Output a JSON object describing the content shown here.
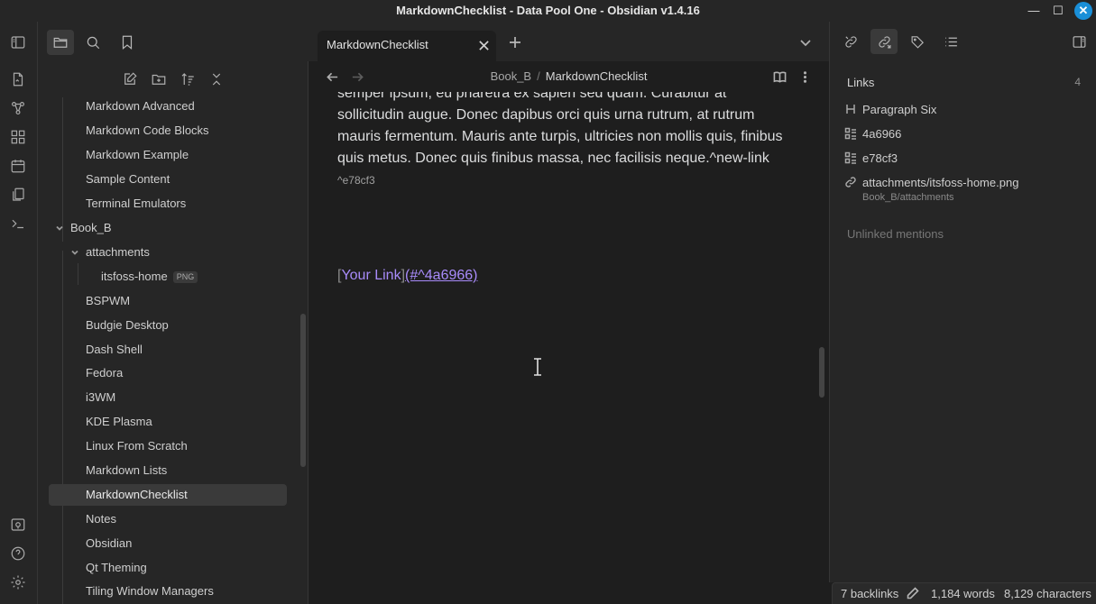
{
  "window": {
    "title": "MarkdownChecklist - Data Pool One - Obsidian v1.4.16",
    "minimize_icon": "minimize-icon",
    "maximize_icon": "maximize-icon",
    "close_icon": "close-icon"
  },
  "colors": {
    "background": "#1e1e1e",
    "panel": "#262626",
    "accent_link": "#a88bfa",
    "close_button": "#1a8fd8"
  },
  "ribbon": {
    "icons": [
      "new-note-icon",
      "graph-view-icon",
      "canvas-icon",
      "daily-note-icon",
      "templates-icon",
      "command-palette-icon",
      "vault-switcher-icon",
      "help-icon",
      "settings-icon"
    ]
  },
  "left_top": {
    "icons": [
      "toggle-left-sidebar-icon",
      "file-explorer-icon",
      "search-icon",
      "bookmarks-icon"
    ]
  },
  "file_nav": {
    "actions": [
      "new-note-icon",
      "new-folder-icon",
      "sort-icon",
      "collapse-all-icon"
    ],
    "items": [
      {
        "label": "Markdown Advanced"
      },
      {
        "label": "Markdown Code Blocks"
      },
      {
        "label": "Markdown Example"
      },
      {
        "label": "Sample Content"
      },
      {
        "label": "Terminal Emulators"
      },
      {
        "label": "Book_B"
      },
      {
        "label": "attachments"
      },
      {
        "label": "itsfoss-home",
        "badge": "PNG"
      },
      {
        "label": "BSPWM"
      },
      {
        "label": "Budgie Desktop"
      },
      {
        "label": "Dash Shell"
      },
      {
        "label": "Fedora"
      },
      {
        "label": "i3WM"
      },
      {
        "label": "KDE Plasma"
      },
      {
        "label": "Linux From Scratch"
      },
      {
        "label": "Markdown Lists"
      },
      {
        "label": "MarkdownChecklist",
        "selected": true
      },
      {
        "label": "Notes"
      },
      {
        "label": "Obsidian"
      },
      {
        "label": "Qt Theming"
      },
      {
        "label": "Tiling Window Managers"
      }
    ]
  },
  "tabs": {
    "active_title": "MarkdownChecklist",
    "new_tab_icon": "plus-icon",
    "tab_list_icon": "chevron-down-icon"
  },
  "editor": {
    "breadcrumb_parent": "Book_B",
    "breadcrumb_sep": "/",
    "breadcrumb_current": "MarkdownChecklist",
    "paragraph_text": "semper ipsum, eu pharetra ex sapien sed quam. Curabitur at sollicitudin augue. Donec dapibus orci quis urna rutrum, at rutrum mauris fermentum. Mauris ante turpis, ultricies non mollis quis, finibus quis metus. Donec quis finibus massa, nec facilisis neque.^new-link",
    "block_id": "^e78cf3",
    "link_open": "[",
    "link_text": "Your Link",
    "link_close": "]",
    "link_url": "(#^4a6966)"
  },
  "right_panel": {
    "title": "Links",
    "count": "4",
    "items": [
      {
        "label": "Paragraph Six",
        "icon": "heading-icon"
      },
      {
        "label": "4a6966",
        "icon": "block-icon"
      },
      {
        "label": "e78cf3",
        "icon": "block-icon"
      },
      {
        "label": "attachments/itsfoss-home.png",
        "icon": "link-icon"
      }
    ],
    "sub_path": "Book_B/attachments",
    "unlinked": "Unlinked mentions"
  },
  "status": {
    "backlinks": "7 backlinks",
    "words": "1,184 words",
    "characters": "8,129 characters"
  }
}
